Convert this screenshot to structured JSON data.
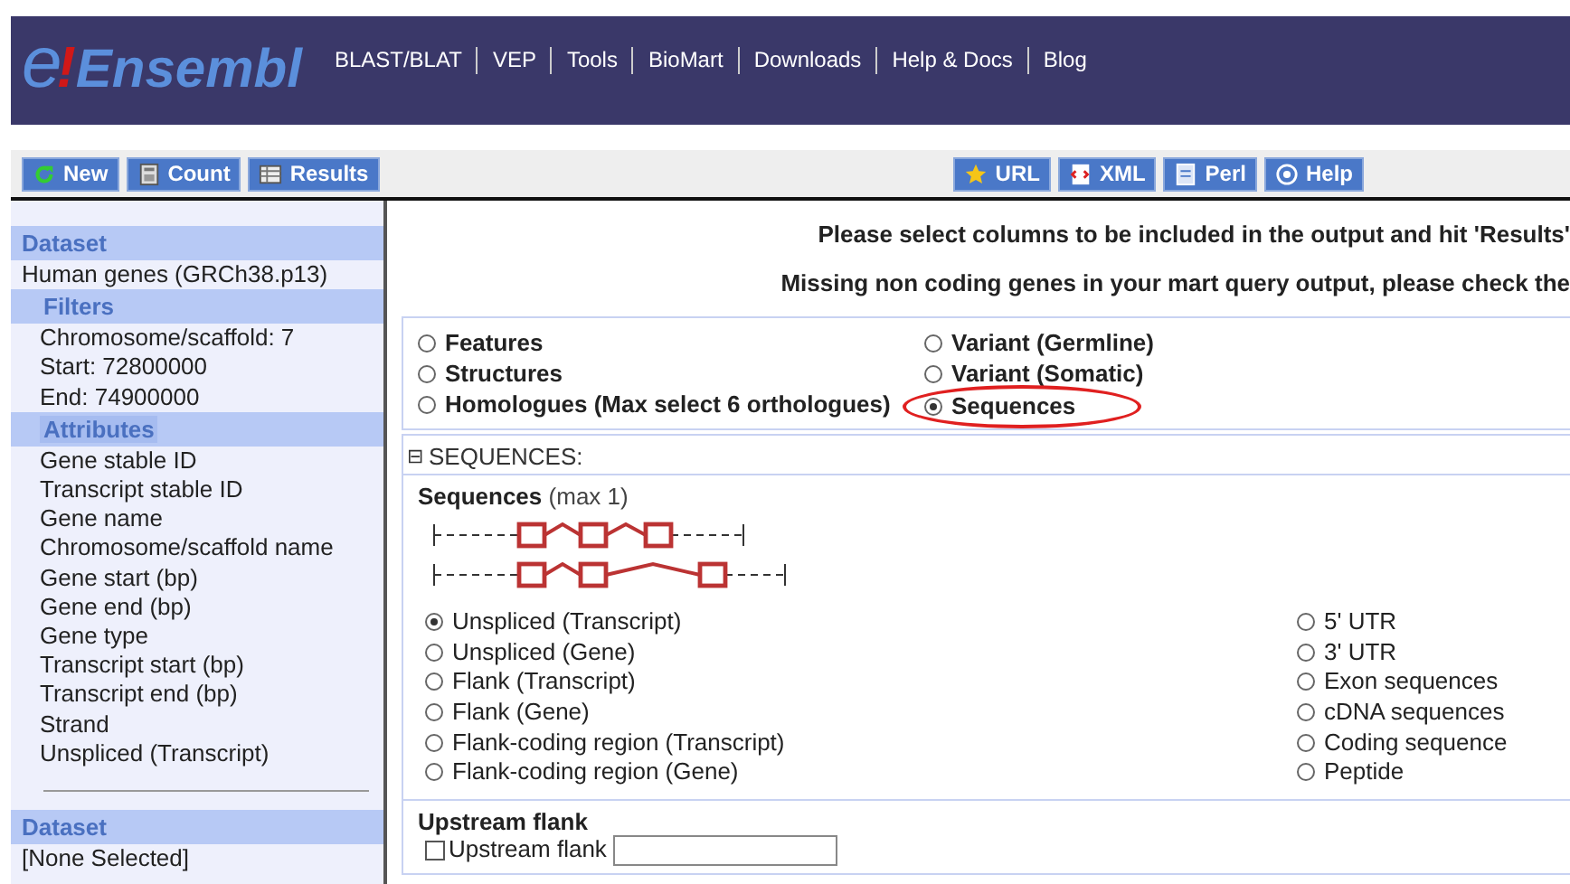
{
  "header": {
    "logo": {
      "e": "e",
      "bang": "!",
      "name": "Ensembl"
    },
    "nav": [
      "BLAST/BLAT",
      "VEP",
      "Tools",
      "BioMart",
      "Downloads",
      "Help & Docs",
      "Blog"
    ]
  },
  "toolbar": {
    "left": [
      {
        "label": "New",
        "kind": "refresh"
      },
      {
        "label": "Count",
        "kind": "calculator"
      },
      {
        "label": "Results",
        "kind": "table"
      }
    ],
    "right": [
      {
        "label": "URL",
        "kind": "star"
      },
      {
        "label": "XML",
        "kind": "xml"
      },
      {
        "label": "Perl",
        "kind": "script"
      },
      {
        "label": "Help",
        "kind": "help"
      }
    ]
  },
  "sidebar": {
    "sections": [
      {
        "kind": "dataset",
        "title": "Dataset",
        "items": [
          "Human genes (GRCh38.p13)"
        ]
      },
      {
        "kind": "sub",
        "title": "Filters",
        "selected": false,
        "items": [
          "Chromosome/scaffold: 7",
          "Start: 72800000",
          "End: 74900000"
        ]
      },
      {
        "kind": "sub",
        "title": "Attributes",
        "selected": true,
        "items": [
          "Gene stable ID",
          "Transcript stable ID",
          "Gene name",
          "Chromosome/scaffold name",
          "Gene start (bp)",
          "Gene end (bp)",
          "Gene type",
          "Transcript start (bp)",
          "Transcript end (bp)",
          "Strand",
          "Unspliced (Transcript)"
        ]
      },
      {
        "kind": "divider"
      },
      {
        "kind": "dataset",
        "title": "Dataset",
        "items": [
          "[None Selected]"
        ]
      }
    ]
  },
  "messages": [
    "Please select columns to be included in the output and hit 'Results'",
    "Missing non coding genes in your mart query output, please check the"
  ],
  "page_types": [
    {
      "label": "Features",
      "selected": false
    },
    {
      "label": "Structures",
      "selected": false
    },
    {
      "label": "Homologues (Max select 6 orthologues)",
      "selected": false
    },
    {
      "label": "Variant (Germline)",
      "selected": false
    },
    {
      "label": "Variant (Somatic)",
      "selected": false
    },
    {
      "label": "Sequences",
      "selected": true,
      "circled": true
    }
  ],
  "section": {
    "toggle": "⊟",
    "title": "SEQUENCES:",
    "heading": "Sequences",
    "note": "(max 1)",
    "options_left": [
      {
        "label": "Unspliced (Transcript)",
        "selected": true
      },
      {
        "label": "Unspliced (Gene)",
        "selected": false
      },
      {
        "label": "Flank (Transcript)",
        "selected": false
      },
      {
        "label": "Flank (Gene)",
        "selected": false
      },
      {
        "label": "Flank-coding region (Transcript)",
        "selected": false
      },
      {
        "label": "Flank-coding region (Gene)",
        "selected": false
      }
    ],
    "options_right": [
      {
        "label": "5' UTR",
        "selected": false
      },
      {
        "label": "3' UTR",
        "selected": false
      },
      {
        "label": "Exon sequences",
        "selected": false
      },
      {
        "label": "cDNA sequences",
        "selected": false
      },
      {
        "label": "Coding sequence",
        "selected": false
      },
      {
        "label": "Peptide",
        "selected": false
      }
    ],
    "upstream": {
      "heading": "Upstream flank",
      "label": "Upstream flank",
      "checked": false
    }
  }
}
